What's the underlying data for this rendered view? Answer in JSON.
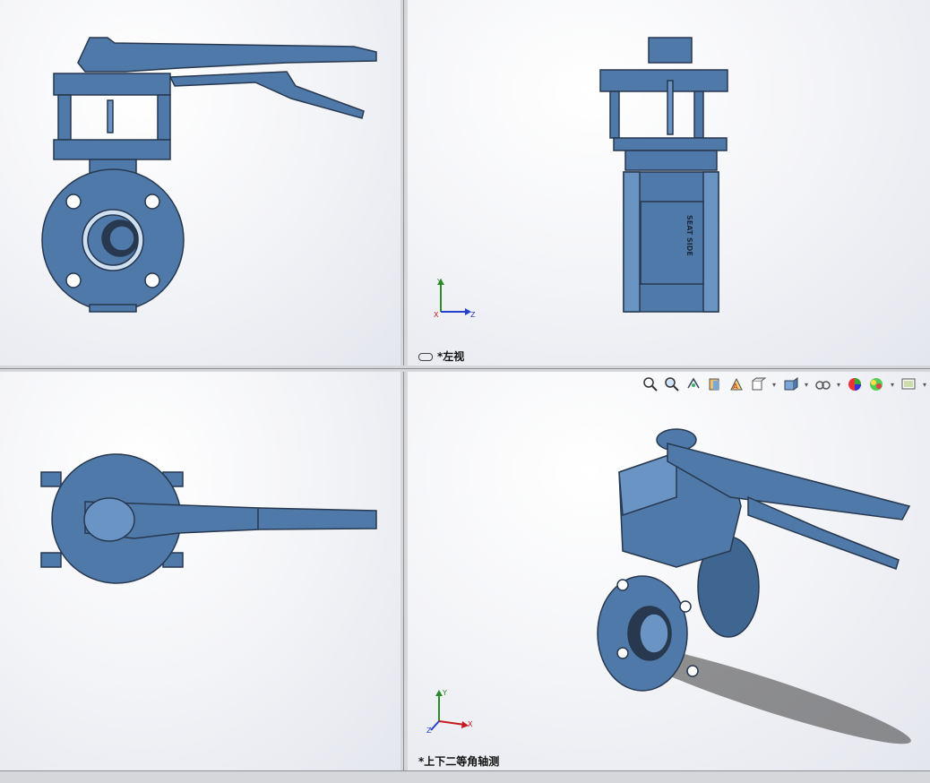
{
  "app": "SolidWorks",
  "viewports": {
    "top_left": {
      "label": ""
    },
    "top_right": {
      "label": "*左视",
      "triad": {
        "y": "Y",
        "x": "X",
        "z": "Z"
      }
    },
    "bottom_left": {
      "label": ""
    },
    "bottom_right": {
      "label": "*上下二等角轴测",
      "triad": {
        "y": "Y",
        "x": "X",
        "z": "Z"
      }
    }
  },
  "part_engraving": "SEAT SIDE",
  "toolbar": {
    "buttons": [
      {
        "name": "zoom-to-fit-icon",
        "arrow": false
      },
      {
        "name": "zoom-to-area-icon",
        "arrow": false
      },
      {
        "name": "previous-view-icon",
        "arrow": false
      },
      {
        "name": "section-view-icon",
        "arrow": false
      },
      {
        "name": "dynamic-annotation-views-icon",
        "arrow": false
      },
      {
        "name": "view-orientation-icon",
        "arrow": true
      },
      {
        "name": "display-style-icon",
        "arrow": true
      },
      {
        "name": "hide-show-items-icon",
        "arrow": true
      },
      {
        "name": "edit-appearance-icon",
        "arrow": false
      },
      {
        "name": "apply-scene-icon",
        "arrow": true
      },
      {
        "name": "view-settings-icon",
        "arrow": true
      }
    ]
  },
  "colors": {
    "model_fill": "#4f79a8",
    "model_dark": "#27384f",
    "model_light": "#6a94c3",
    "axis_x": "#c8191e",
    "axis_y": "#2d8a2d",
    "axis_z": "#2540c8"
  }
}
